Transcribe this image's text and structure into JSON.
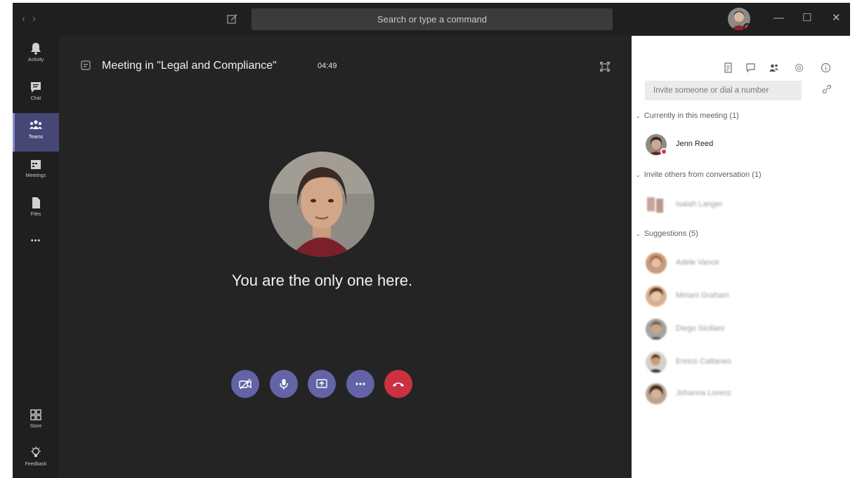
{
  "titlebar": {
    "back_glyph": "‹",
    "forward_glyph": "›",
    "search_placeholder": "Search or type a command",
    "minimize_glyph": "—",
    "maximize_glyph": "☐",
    "close_glyph": "✕"
  },
  "rail": {
    "items": [
      {
        "label": "Activity",
        "icon": "bell-icon"
      },
      {
        "label": "Chat",
        "icon": "chat-icon"
      },
      {
        "label": "Teams",
        "icon": "teams-icon",
        "active": true
      },
      {
        "label": "Meetings",
        "icon": "calendar-icon"
      },
      {
        "label": "Files",
        "icon": "file-icon"
      }
    ],
    "more_glyph": "•••",
    "bottom_items": [
      {
        "label": "Store",
        "icon": "store-icon"
      },
      {
        "label": "Feedback",
        "icon": "lightbulb-icon"
      }
    ]
  },
  "meeting": {
    "title": "Meeting in \"Legal and Compliance\"",
    "timer": "04:49",
    "status_message": "You are the only one here."
  },
  "controls": [
    "camera-off-icon",
    "microphone-icon",
    "share-screen-icon",
    "more-options-icon",
    "hang-up-icon"
  ],
  "panel": {
    "invite_placeholder": "Invite someone or dial a number",
    "sections": {
      "current": "Currently in this meeting (1)",
      "invite_others": "Invite others from conversation (1)",
      "suggestions": "Suggestions (5)"
    },
    "current_participants": [
      {
        "name": "Jenn Reed"
      }
    ],
    "conversation_people": [
      {
        "name": "Isaiah Langer"
      }
    ],
    "suggested_people": [
      {
        "name": "Adele Vance"
      },
      {
        "name": "Miriam Graham"
      },
      {
        "name": "Diego Siciliani"
      },
      {
        "name": "Enrico Cattaneo"
      },
      {
        "name": "Johanna Lorenz"
      }
    ]
  },
  "colors": {
    "brand": "#6264a7",
    "hangup": "#cc3142",
    "rail_active": "#464775",
    "presence_busy": "#d6393e",
    "stage_bg": "#242424"
  }
}
